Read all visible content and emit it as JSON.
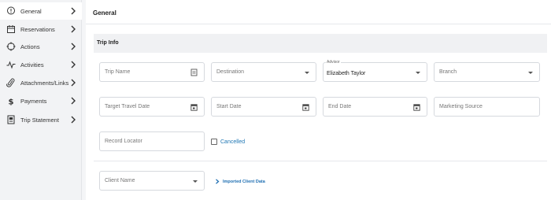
{
  "sidebar": {
    "items": [
      {
        "label": "General",
        "icon": "info-pin-icon",
        "active": true
      },
      {
        "label": "Reservations",
        "icon": "calendar-icon"
      },
      {
        "label": "Actions",
        "icon": "target-icon"
      },
      {
        "label": "Activities",
        "icon": "pulse-icon"
      },
      {
        "label": "Attachments/Links",
        "icon": "paperclip-icon"
      },
      {
        "label": "Payments",
        "icon": "dollar-icon"
      },
      {
        "label": "Trip Statement",
        "icon": "document-icon"
      }
    ]
  },
  "main": {
    "title": "General",
    "section": {
      "title": "Trip Info"
    },
    "fields": {
      "trip_name": {
        "placeholder": "Trip Name"
      },
      "destination": {
        "placeholder": "Destination"
      },
      "advisor": {
        "label": "Advisor",
        "value": "Elizabeth Taylor"
      },
      "branch": {
        "placeholder": "Branch"
      },
      "target_travel_date": {
        "placeholder": "Target Travel Date"
      },
      "start_date": {
        "placeholder": "Start Date"
      },
      "end_date": {
        "placeholder": "End Date"
      },
      "marketing_source": {
        "placeholder": "Marketing Source"
      },
      "record_locator": {
        "placeholder": "Record Locator"
      },
      "cancelled": {
        "label": "Cancelled",
        "checked": false
      },
      "client_name": {
        "placeholder": "Client Name"
      }
    },
    "imported_link": "Imported Client Data"
  },
  "colors": {
    "link": "#1f6fb2",
    "checkbox_label": "#1f77b4",
    "sidebar_bg": "#f2f3f5"
  }
}
